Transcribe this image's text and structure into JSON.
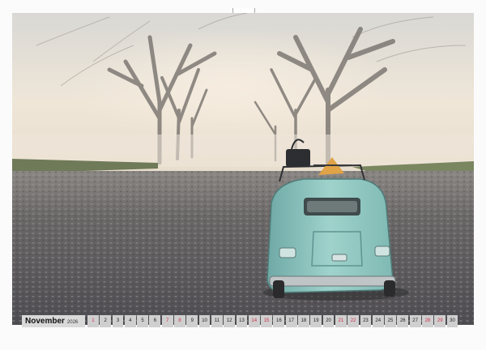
{
  "calendar": {
    "month": "November",
    "year": "2026",
    "days": [
      {
        "n": "1",
        "weekend": true
      },
      {
        "n": "2",
        "weekend": false
      },
      {
        "n": "3",
        "weekend": false
      },
      {
        "n": "4",
        "weekend": false
      },
      {
        "n": "5",
        "weekend": false
      },
      {
        "n": "6",
        "weekend": false
      },
      {
        "n": "7",
        "weekend": true
      },
      {
        "n": "8",
        "weekend": true
      },
      {
        "n": "9",
        "weekend": false
      },
      {
        "n": "10",
        "weekend": false
      },
      {
        "n": "11",
        "weekend": false
      },
      {
        "n": "12",
        "weekend": false
      },
      {
        "n": "13",
        "weekend": false
      },
      {
        "n": "14",
        "weekend": true
      },
      {
        "n": "15",
        "weekend": true
      },
      {
        "n": "16",
        "weekend": false
      },
      {
        "n": "17",
        "weekend": false
      },
      {
        "n": "18",
        "weekend": false
      },
      {
        "n": "19",
        "weekend": false
      },
      {
        "n": "20",
        "weekend": false
      },
      {
        "n": "21",
        "weekend": true
      },
      {
        "n": "22",
        "weekend": true
      },
      {
        "n": "23",
        "weekend": false
      },
      {
        "n": "24",
        "weekend": false
      },
      {
        "n": "25",
        "weekend": false
      },
      {
        "n": "26",
        "weekend": false
      },
      {
        "n": "27",
        "weekend": false
      },
      {
        "n": "28",
        "weekend": true
      },
      {
        "n": "29",
        "weekend": true
      },
      {
        "n": "30",
        "weekend": false
      }
    ]
  },
  "colors": {
    "weekend": "#d0314c",
    "car": "#8fc7c0",
    "sky": "#e8e2d6",
    "road": "#5f5f63"
  }
}
